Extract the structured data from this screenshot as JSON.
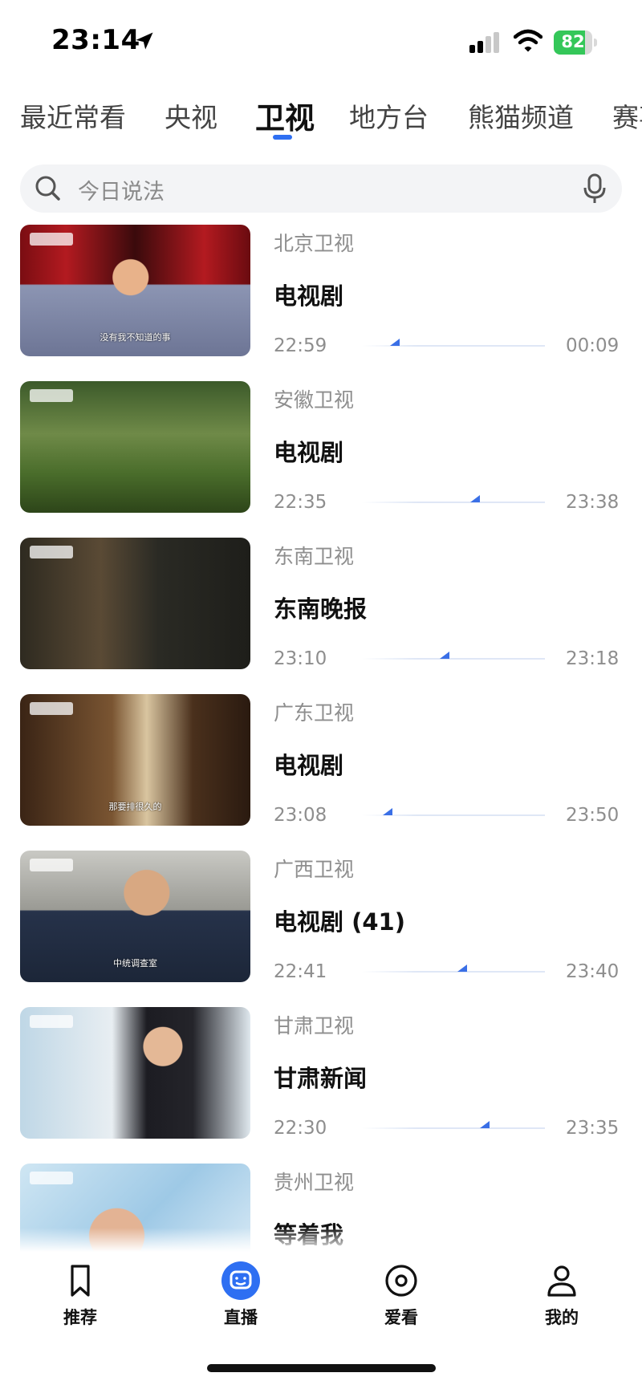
{
  "status": {
    "time": "23:14",
    "battery": "82",
    "battery_fraction": 0.82
  },
  "tabs": [
    "最近常看",
    "央视",
    "卫视",
    "地方台",
    "熊猫频道",
    "赛事"
  ],
  "active_tab_index": 2,
  "search": {
    "placeholder": "今日说法"
  },
  "channels": [
    {
      "name": "北京卫视",
      "program": "电视剧",
      "start": "22:59",
      "end": "00:09",
      "progress": 0.18,
      "thumb_caption": "没有我不知道的事"
    },
    {
      "name": "安徽卫视",
      "program": "电视剧",
      "start": "22:35",
      "end": "23:38",
      "progress": 0.62,
      "thumb_caption": ""
    },
    {
      "name": "东南卫视",
      "program": "东南晚报",
      "start": "23:10",
      "end": "23:18",
      "progress": 0.45,
      "thumb_caption": ""
    },
    {
      "name": "广东卫视",
      "program": "电视剧",
      "start": "23:08",
      "end": "23:50",
      "progress": 0.14,
      "thumb_caption": "那要排很久的"
    },
    {
      "name": "广西卫视",
      "program": "电视剧 (41)",
      "start": "22:41",
      "end": "23:40",
      "progress": 0.55,
      "thumb_caption": "中统调查室"
    },
    {
      "name": "甘肃卫视",
      "program": "甘肃新闻",
      "start": "22:30",
      "end": "23:35",
      "progress": 0.67,
      "thumb_caption": ""
    },
    {
      "name": "贵州卫视",
      "program": "等着我",
      "start": "",
      "end": "",
      "progress": null,
      "thumb_caption": ""
    }
  ],
  "bottom_nav": [
    {
      "label": "推荐",
      "icon": "bookmark-icon"
    },
    {
      "label": "直播",
      "icon": "tv-face-icon"
    },
    {
      "label": "爱看",
      "icon": "target-icon"
    },
    {
      "label": "我的",
      "icon": "person-icon"
    }
  ],
  "active_nav_index": 1,
  "colors": {
    "accent": "#2e6ff2",
    "battery": "#34c759"
  }
}
